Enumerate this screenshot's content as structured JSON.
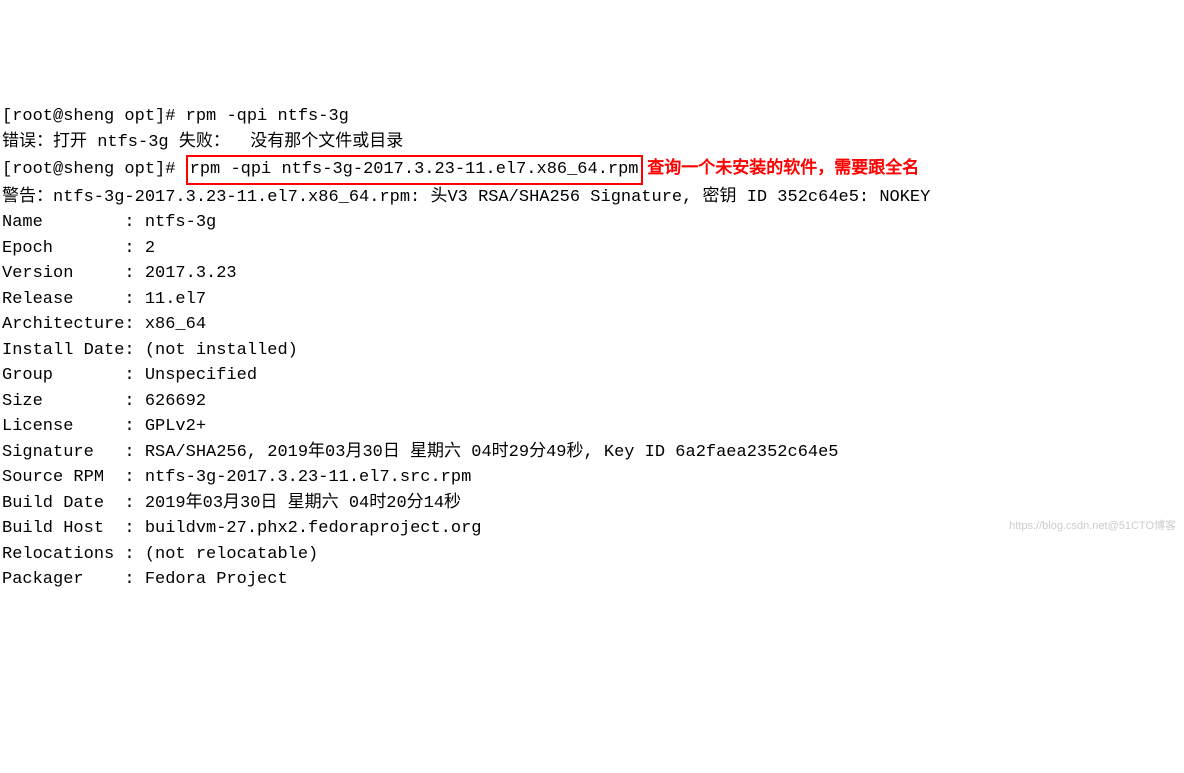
{
  "line1_prompt": "[root@sheng opt]# ",
  "line1_cmd": "rpm -qpi ntfs-3g",
  "line2": "错误：打开 ntfs-3g 失败：  没有那个文件或目录",
  "line3_prompt": "[root@sheng opt]# ",
  "line3_cmd": "rpm -qpi ntfs-3g-2017.3.23-11.el7.x86_64.rpm",
  "line3_annotation": " 查询一个未安装的软件，需要跟全名",
  "line4": "警告：ntfs-3g-2017.3.23-11.el7.x86_64.rpm: 头V3 RSA/SHA256 Signature, 密钥 ID 352c64e5: NOKEY",
  "fields": {
    "name": "Name        : ntfs-3g",
    "epoch": "Epoch       : 2",
    "version": "Version     : 2017.3.23",
    "release": "Release     : 11.el7",
    "arch": "Architecture: x86_64",
    "installdate": "Install Date: (not installed)",
    "group": "Group       : Unspecified",
    "size": "Size        : 626692",
    "license": "License     : GPLv2+",
    "signature": "Signature   : RSA/SHA256, 2019年03月30日 星期六 04时29分49秒, Key ID 6a2faea2352c64e5",
    "sourcerpm": "Source RPM  : ntfs-3g-2017.3.23-11.el7.src.rpm",
    "builddate": "Build Date  : 2019年03月30日 星期六 04时20分14秒",
    "buildhost": "Build Host  : buildvm-27.phx2.fedoraproject.org",
    "relocations": "Relocations : (not relocatable)",
    "packager": "Packager    : Fedora Project"
  },
  "watermark": "https://blog.csdn.net@51CTO博客"
}
